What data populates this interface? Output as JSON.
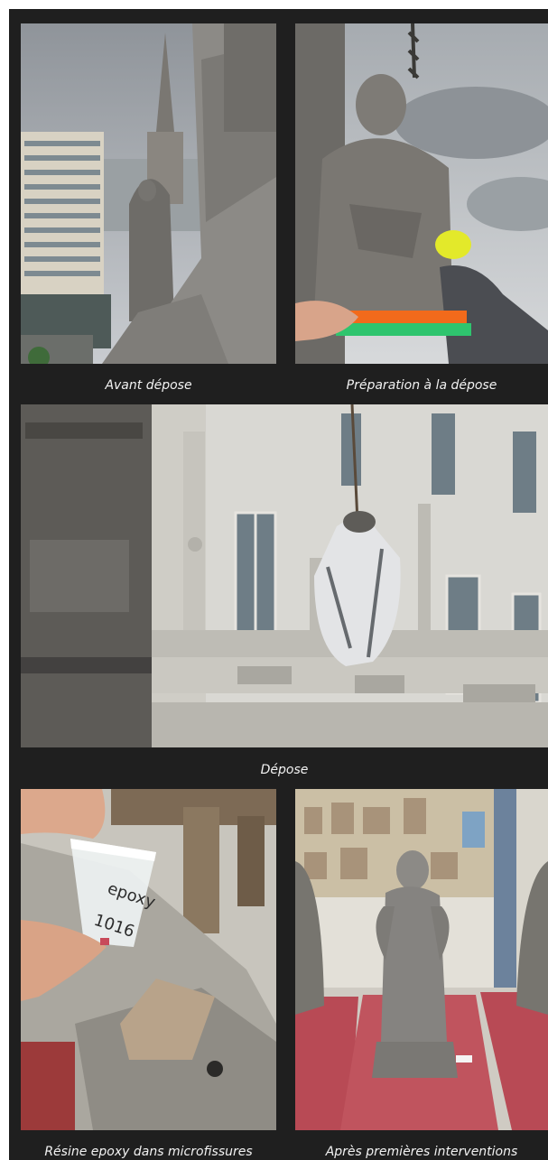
{
  "captions": {
    "before_removal": "Avant dépose",
    "preparation": "Préparation à la dépose",
    "removal": "Dépose",
    "epoxy_resin": "Résine epoxy dans microfissures",
    "after_interventions": "Après premières interventions"
  },
  "photos": {
    "cup_text_line1": "epoxy",
    "cup_text_line2": "1016"
  },
  "colors": {
    "panel_background": "#1f1f1f",
    "caption_text": "#f2f2f2",
    "strap_orange": "#f26a1b",
    "strap_green": "#2fc46e",
    "plinth_red": "#b84a55"
  }
}
